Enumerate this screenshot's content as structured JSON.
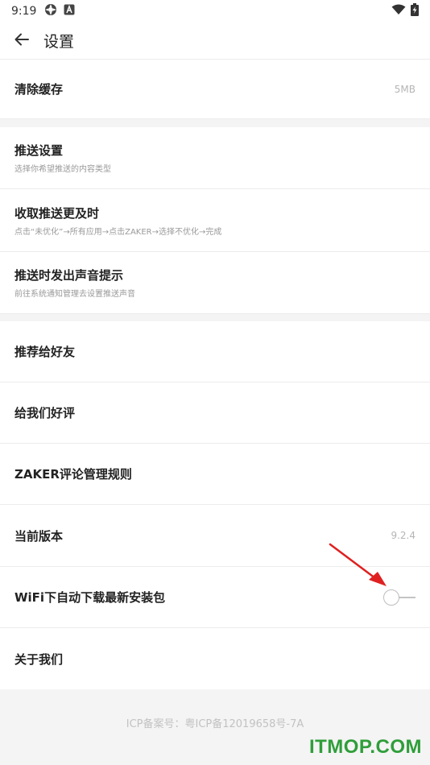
{
  "status_bar": {
    "time": "9:19",
    "icons": [
      "settings-gear-icon",
      "a-badge-icon",
      "wifi-icon",
      "battery-charging-icon"
    ]
  },
  "app_bar": {
    "back_icon": "arrow-left-icon",
    "title": "设置"
  },
  "sections": {
    "cache": {
      "label": "清除缓存",
      "value": "5MB"
    },
    "push_settings": {
      "label": "推送设置",
      "sub": "选择你希望推送的内容类型"
    },
    "push_timely": {
      "label": "收取推送更及时",
      "sub": "点击“未优化”→所有应用→点击ZAKER→选择不优化→完成"
    },
    "push_sound": {
      "label": "推送时发出声音提示",
      "sub": "前往系统通知管理去设置推送声音"
    },
    "recommend": {
      "label": "推荐给好友"
    },
    "rate": {
      "label": "给我们好评"
    },
    "comment_rules": {
      "label": "ZAKER评论管理规则"
    },
    "version": {
      "label": "当前版本",
      "value": "9.2.4"
    },
    "wifi_download": {
      "label": "WiFi下自动下载最新安装包",
      "enabled": false
    },
    "about": {
      "label": "关于我们"
    }
  },
  "footer": {
    "icp": "ICP备案号：粤ICP备12019658号-7A",
    "watermark": "ITMOP.COM"
  },
  "colors": {
    "annotation_arrow": "#e02020",
    "watermark": "#2f9e3a",
    "background": "#f4f4f4"
  }
}
